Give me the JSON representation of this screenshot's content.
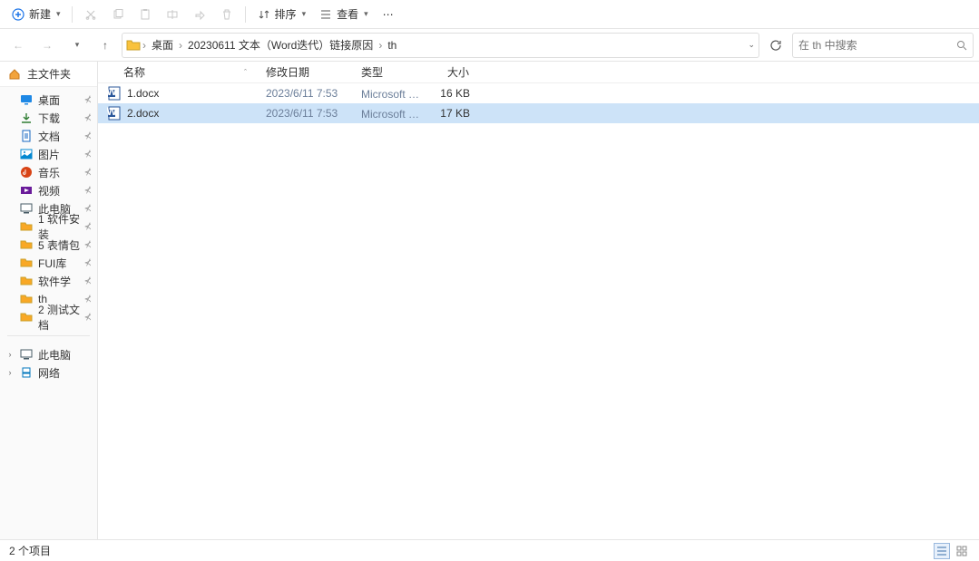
{
  "toolbar": {
    "new_label": "新建",
    "sort_label": "排序",
    "view_label": "查看"
  },
  "breadcrumb": [
    "桌面",
    "20230611 文本（Word迭代）链接原因",
    "th"
  ],
  "search_placeholder": "在 th 中搜索",
  "sidebar": {
    "header": "主文件夹",
    "quick": [
      {
        "label": "桌面",
        "icon": "desktop",
        "color": "#1e88e5",
        "pin": true
      },
      {
        "label": "下载",
        "icon": "download",
        "color": "#2e7d32",
        "pin": true
      },
      {
        "label": "文档",
        "icon": "doc",
        "color": "#1565c0",
        "pin": true
      },
      {
        "label": "图片",
        "icon": "pic",
        "color": "#0288d1",
        "pin": true
      },
      {
        "label": "音乐",
        "icon": "music",
        "color": "#d84315",
        "pin": true
      },
      {
        "label": "视频",
        "icon": "video",
        "color": "#6a1b9a",
        "pin": true
      },
      {
        "label": "此电脑",
        "icon": "pc",
        "color": "#455a64",
        "pin": true
      },
      {
        "label": "1 软件安装",
        "icon": "folder",
        "color": "#f9a825",
        "pin": true
      },
      {
        "label": "5 表情包",
        "icon": "folder",
        "color": "#f9a825",
        "pin": true
      },
      {
        "label": "FUI库",
        "icon": "folder",
        "color": "#f9a825",
        "pin": true
      },
      {
        "label": "软件学",
        "icon": "folder",
        "color": "#f9a825",
        "pin": true
      },
      {
        "label": "th",
        "icon": "folder",
        "color": "#f9a825",
        "pin": true
      },
      {
        "label": "2 测试文档",
        "icon": "folder",
        "color": "#f9a825",
        "pin": true
      }
    ],
    "tree": [
      {
        "label": "此电脑",
        "icon": "pc",
        "color": "#455a64"
      },
      {
        "label": "网络",
        "icon": "net",
        "color": "#0277bd"
      }
    ]
  },
  "columns": {
    "name": "名称",
    "date": "修改日期",
    "type": "类型",
    "size": "大小"
  },
  "files": [
    {
      "name": "1.docx",
      "date": "2023/6/11 7:53",
      "type": "Microsoft Word 文档",
      "size": "16 KB",
      "sel": false
    },
    {
      "name": "2.docx",
      "date": "2023/6/11 7:53",
      "type": "Microsoft Word 文档",
      "size": "17 KB",
      "sel": true
    }
  ],
  "status_text": "2 个项目"
}
